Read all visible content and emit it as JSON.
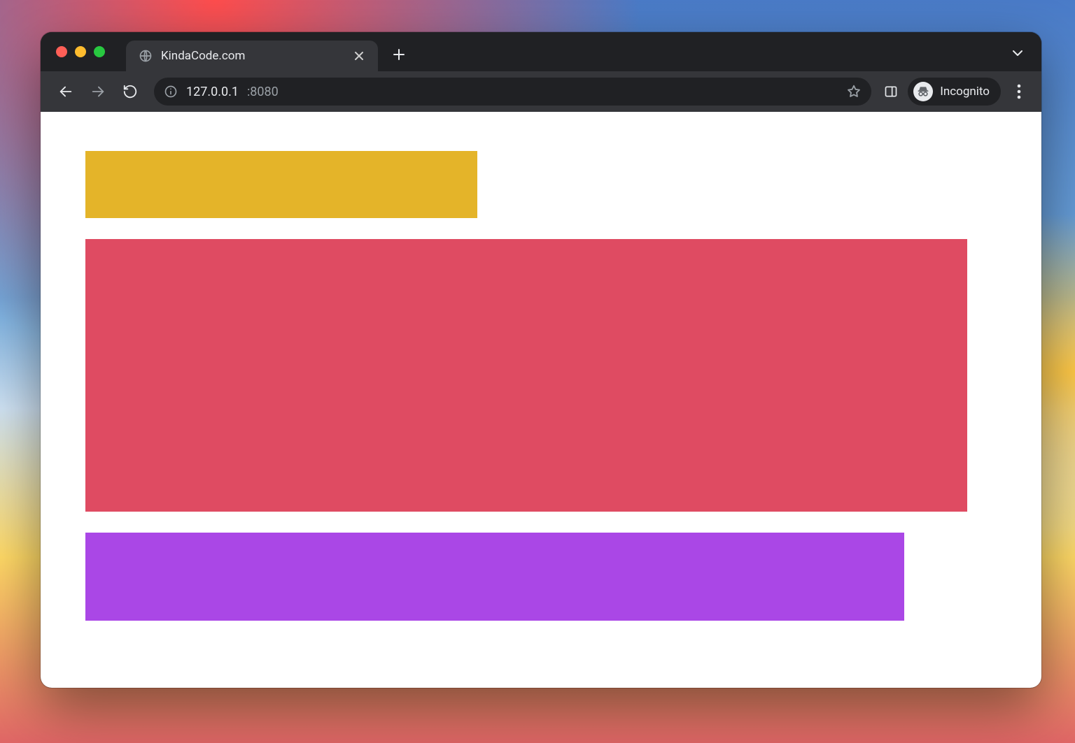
{
  "browser": {
    "tab": {
      "title": "KindaCode.com"
    },
    "address": {
      "host": "127.0.0.1",
      "port": ":8080"
    },
    "incognito_label": "Incognito"
  },
  "content": {
    "boxes": [
      {
        "color": "#e4b429"
      },
      {
        "color": "#df4b62"
      },
      {
        "color": "#aa47e6"
      }
    ]
  }
}
